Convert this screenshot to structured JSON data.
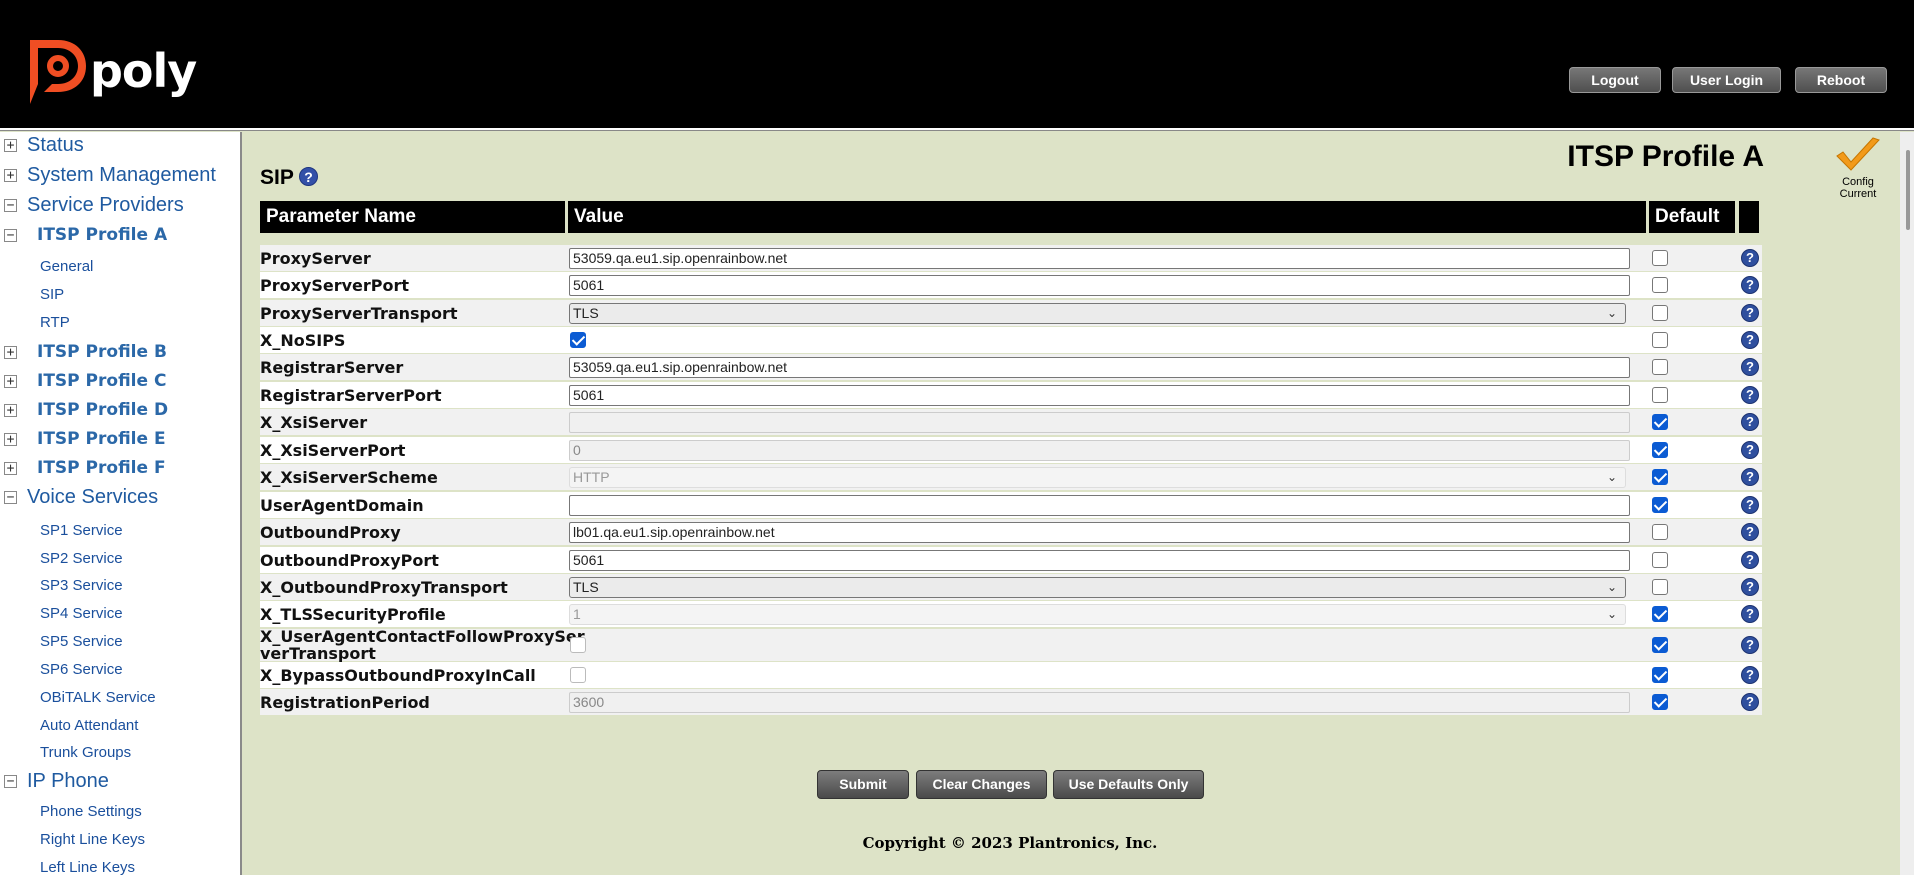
{
  "brand": {
    "name": "poly",
    "accent": "#f04e23"
  },
  "header": {
    "buttons": [
      "Logout",
      "User Login",
      "Reboot"
    ]
  },
  "sidebar": {
    "items": [
      {
        "label": "Status",
        "level": 0,
        "expander": "+"
      },
      {
        "label": "System Management",
        "level": 0,
        "expander": "+"
      },
      {
        "label": "Service Providers",
        "level": 0,
        "expander": "−"
      },
      {
        "label": "ITSP Profile A",
        "level": 1,
        "expander": "−"
      },
      {
        "label": "General",
        "level": 2
      },
      {
        "label": "SIP",
        "level": 2
      },
      {
        "label": "RTP",
        "level": 2
      },
      {
        "label": "ITSP Profile B",
        "level": 1,
        "expander": "+"
      },
      {
        "label": "ITSP Profile C",
        "level": 1,
        "expander": "+"
      },
      {
        "label": "ITSP Profile D",
        "level": 1,
        "expander": "+"
      },
      {
        "label": "ITSP Profile E",
        "level": 1,
        "expander": "+"
      },
      {
        "label": "ITSP Profile F",
        "level": 1,
        "expander": "+"
      },
      {
        "label": "Voice Services",
        "level": 0,
        "expander": "−"
      },
      {
        "label": "SP1 Service",
        "level": 2
      },
      {
        "label": "SP2 Service",
        "level": 2
      },
      {
        "label": "SP3 Service",
        "level": 2
      },
      {
        "label": "SP4 Service",
        "level": 2
      },
      {
        "label": "SP5 Service",
        "level": 2
      },
      {
        "label": "SP6 Service",
        "level": 2
      },
      {
        "label": "OBiTALK Service",
        "level": 2
      },
      {
        "label": "Auto Attendant",
        "level": 2
      },
      {
        "label": "Trunk Groups",
        "level": 2
      },
      {
        "label": "IP Phone",
        "level": 0,
        "expander": "−"
      },
      {
        "label": "Phone Settings",
        "level": 2
      },
      {
        "label": "Right Line Keys",
        "level": 2
      },
      {
        "label": "Left Line Keys",
        "level": 2
      }
    ]
  },
  "main": {
    "page_title": "ITSP Profile A",
    "config_status": [
      "Config",
      "Current"
    ],
    "section_title": "SIP",
    "help_glyph": "?",
    "columns": [
      "Parameter Name",
      "Value",
      "Default"
    ],
    "rows": [
      {
        "name": "ProxyServer",
        "type": "text",
        "value": "53059.qa.eu1.sip.openrainbow.net",
        "enabled": true,
        "default": false
      },
      {
        "name": "ProxyServerPort",
        "type": "text",
        "value": "5061",
        "enabled": true,
        "default": false
      },
      {
        "name": "ProxyServerTransport",
        "type": "select",
        "value": "TLS",
        "enabled": true,
        "default": false
      },
      {
        "name": "X_NoSIPS",
        "type": "checkbox",
        "checked": true,
        "enabled": true,
        "default": false
      },
      {
        "name": "RegistrarServer",
        "type": "text",
        "value": "53059.qa.eu1.sip.openrainbow.net",
        "enabled": true,
        "default": false
      },
      {
        "name": "RegistrarServerPort",
        "type": "text",
        "value": "5061",
        "enabled": true,
        "default": false
      },
      {
        "name": "X_XsiServer",
        "type": "text",
        "value": "",
        "enabled": false,
        "default": true
      },
      {
        "name": "X_XsiServerPort",
        "type": "text",
        "value": "0",
        "enabled": false,
        "default": true
      },
      {
        "name": "X_XsiServerScheme",
        "type": "select",
        "value": "HTTP",
        "enabled": false,
        "default": true
      },
      {
        "name": "UserAgentDomain",
        "type": "text",
        "value": "",
        "enabled": true,
        "default": true
      },
      {
        "name": "OutboundProxy",
        "type": "text",
        "value": "lb01.qa.eu1.sip.openrainbow.net",
        "enabled": true,
        "default": false
      },
      {
        "name": "OutboundProxyPort",
        "type": "text",
        "value": "5061",
        "enabled": true,
        "default": false
      },
      {
        "name": "X_OutboundProxyTransport",
        "type": "select",
        "value": "TLS",
        "enabled": true,
        "default": false
      },
      {
        "name": "X_TLSSecurityProfile",
        "type": "select",
        "value": "1",
        "enabled": false,
        "default": true
      },
      {
        "name": "X_UserAgentContactFollowProxySer verTransport",
        "type": "checkbox",
        "checked": false,
        "enabled": false,
        "default": true
      },
      {
        "name": "X_BypassOutboundProxyInCall",
        "type": "checkbox",
        "checked": false,
        "enabled": false,
        "default": true
      },
      {
        "name": "RegistrationPeriod",
        "type": "text",
        "value": "3600",
        "enabled": false,
        "default": true
      }
    ]
  },
  "actions": [
    "Submit",
    "Clear Changes",
    "Use Defaults Only"
  ],
  "footer": {
    "copyright": "Copyright © 2023 Plantronics, Inc."
  }
}
